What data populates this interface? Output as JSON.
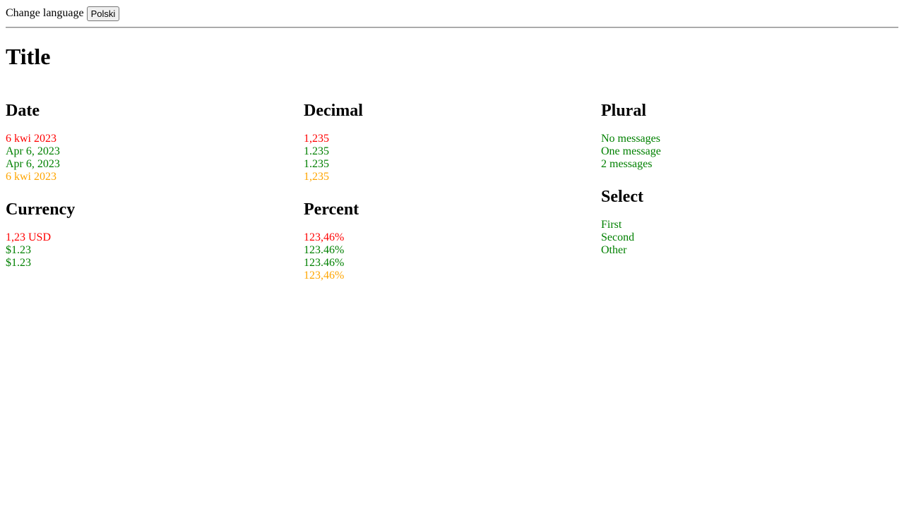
{
  "header": {
    "change_language_label": "Change language",
    "language_button_label": "Polski"
  },
  "page": {
    "title": "Title"
  },
  "colors": {
    "red": "#ff0000",
    "green": "#008000",
    "orange": "#ffa500"
  },
  "sections": {
    "date": {
      "heading": "Date",
      "lines": [
        {
          "text": "6 kwi 2023",
          "color": "red"
        },
        {
          "text": "Apr 6, 2023",
          "color": "green"
        },
        {
          "text": "Apr 6, 2023",
          "color": "green"
        },
        {
          "text": "6 kwi 2023",
          "color": "orange"
        }
      ]
    },
    "currency": {
      "heading": "Currency",
      "lines": [
        {
          "text": "1,23 USD",
          "color": "red"
        },
        {
          "text": "$1.23",
          "color": "green"
        },
        {
          "text": "$1.23",
          "color": "green"
        }
      ]
    },
    "decimal": {
      "heading": "Decimal",
      "lines": [
        {
          "text": "1,235",
          "color": "red"
        },
        {
          "text": "1.235",
          "color": "green"
        },
        {
          "text": "1.235",
          "color": "green"
        },
        {
          "text": "1,235",
          "color": "orange"
        }
      ]
    },
    "percent": {
      "heading": "Percent",
      "lines": [
        {
          "text": "123,46%",
          "color": "red"
        },
        {
          "text": "123.46%",
          "color": "green"
        },
        {
          "text": "123.46%",
          "color": "green"
        },
        {
          "text": "123,46%",
          "color": "orange"
        }
      ]
    },
    "plural": {
      "heading": "Plural",
      "lines": [
        {
          "text": "No messages",
          "color": "green"
        },
        {
          "text": "One message",
          "color": "green"
        },
        {
          "text": "2 messages",
          "color": "green"
        }
      ]
    },
    "select": {
      "heading": "Select",
      "lines": [
        {
          "text": "First",
          "color": "green"
        },
        {
          "text": "Second",
          "color": "green"
        },
        {
          "text": "Other",
          "color": "green"
        }
      ]
    }
  }
}
